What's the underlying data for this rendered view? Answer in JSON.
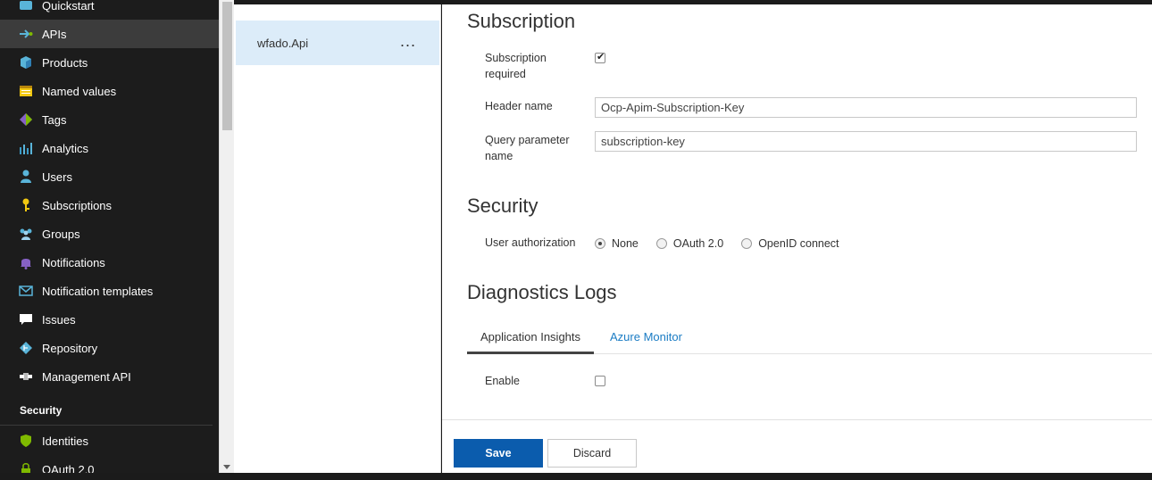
{
  "sidebar": {
    "items": [
      {
        "label": "Quickstart",
        "icon": "cloud-icon",
        "color": "#59b4d9"
      },
      {
        "label": "APIs",
        "icon": "api-arrow-icon",
        "color": "#59b4d9"
      },
      {
        "label": "Products",
        "icon": "cube-icon",
        "color": "#59b4d9"
      },
      {
        "label": "Named values",
        "icon": "table-icon",
        "color": "#f2c811"
      },
      {
        "label": "Tags",
        "icon": "tag-icon",
        "color": "#8661c5"
      },
      {
        "label": "Analytics",
        "icon": "bar-chart-icon",
        "color": "#3999c6"
      },
      {
        "label": "Users",
        "icon": "user-icon",
        "color": "#59b4d9"
      },
      {
        "label": "Subscriptions",
        "icon": "key-icon",
        "color": "#f2c811"
      },
      {
        "label": "Groups",
        "icon": "group-icon",
        "color": "#59b4d9"
      },
      {
        "label": "Notifications",
        "icon": "bell-icon",
        "color": "#8661c5"
      },
      {
        "label": "Notification templates",
        "icon": "mail-icon",
        "color": "#59b4d9"
      },
      {
        "label": "Issues",
        "icon": "comment-icon",
        "color": "#ffffff"
      },
      {
        "label": "Repository",
        "icon": "repository-icon",
        "color": "#59b4d9"
      },
      {
        "label": "Management API",
        "icon": "connector-icon",
        "color": "#ffffff"
      }
    ],
    "section_label": "Security",
    "security_items": [
      {
        "label": "Identities",
        "icon": "shield-icon",
        "color": "#7fba00"
      },
      {
        "label": "OAuth 2.0",
        "icon": "lock-icon",
        "color": "#7fba00"
      }
    ]
  },
  "api_list": {
    "selected_api": "wfado.Api",
    "more_label": "..."
  },
  "subscription": {
    "title": "Subscription",
    "required_label_1": "Subscription",
    "required_label_2": "required",
    "required_checked": true,
    "header_name_label": "Header name",
    "header_name_value": "Ocp-Apim-Subscription-Key",
    "query_label_1": "Query parameter",
    "query_label_2": "name",
    "query_value": "subscription-key"
  },
  "security": {
    "title": "Security",
    "user_auth_label": "User authorization",
    "options": [
      "None",
      "OAuth 2.0",
      "OpenID connect"
    ],
    "selected": "None"
  },
  "diagnostics": {
    "title": "Diagnostics Logs",
    "tabs": [
      "Application Insights",
      "Azure Monitor"
    ],
    "active_tab": "Application Insights",
    "enable_label": "Enable",
    "enable_checked": false
  },
  "footer": {
    "save_label": "Save",
    "discard_label": "Discard"
  }
}
